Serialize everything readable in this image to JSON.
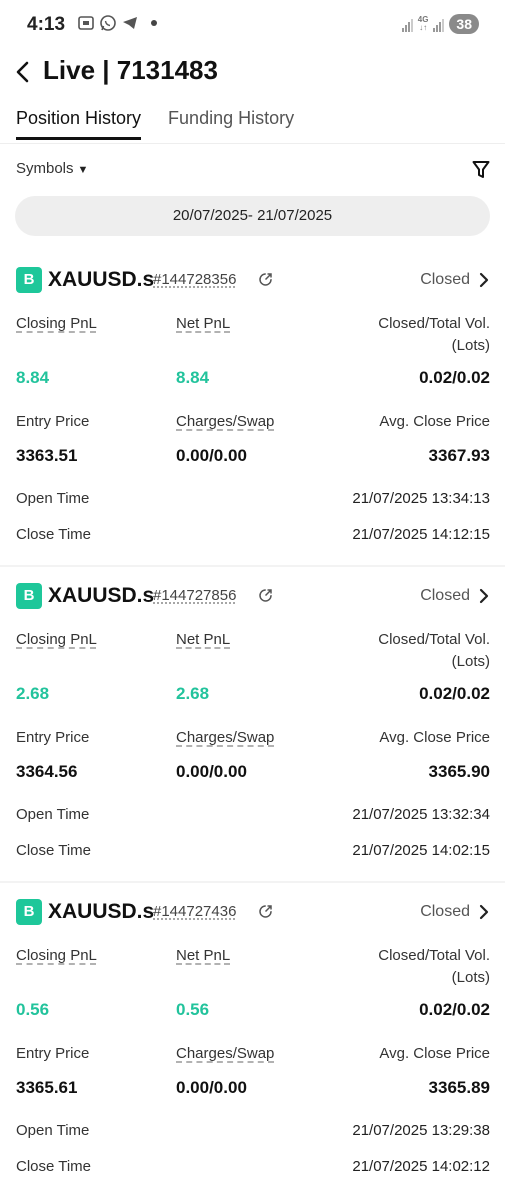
{
  "status_bar": {
    "time": "4:13",
    "network": "4G",
    "battery": "38"
  },
  "header": {
    "title": "Live | 7131483"
  },
  "tabs": [
    {
      "label": "Position History",
      "active": true
    },
    {
      "label": "Funding History",
      "active": false
    }
  ],
  "filter": {
    "symbols_label": "Symbols",
    "date_range": "20/07/2025- 21/07/2025"
  },
  "labels": {
    "closing_pnl": "Closing PnL",
    "net_pnl": "Net PnL",
    "closed_total_vol": "Closed/Total Vol.",
    "lots": "(Lots)",
    "entry_price": "Entry Price",
    "charges_swap": "Charges/Swap",
    "avg_close_price": "Avg. Close Price",
    "open_time": "Open Time",
    "close_time": "Close Time"
  },
  "positions": [
    {
      "badge": "B",
      "symbol": "XAUUSD.s",
      "order_id": "#144728356",
      "status": "Closed",
      "closing_pnl": "8.84",
      "net_pnl": "8.84",
      "volume": "0.02/0.02",
      "entry_price": "3363.51",
      "charges_swap": "0.00/0.00",
      "avg_close_price": "3367.93",
      "open_time": "21/07/2025 13:34:13",
      "close_time": "21/07/2025 14:12:15"
    },
    {
      "badge": "B",
      "symbol": "XAUUSD.s",
      "order_id": "#144727856",
      "status": "Closed",
      "closing_pnl": "2.68",
      "net_pnl": "2.68",
      "volume": "0.02/0.02",
      "entry_price": "3364.56",
      "charges_swap": "0.00/0.00",
      "avg_close_price": "3365.90",
      "open_time": "21/07/2025 13:32:34",
      "close_time": "21/07/2025 14:02:15"
    },
    {
      "badge": "B",
      "symbol": "XAUUSD.s",
      "order_id": "#144727436",
      "status": "Closed",
      "closing_pnl": "0.56",
      "net_pnl": "0.56",
      "volume": "0.02/0.02",
      "entry_price": "3365.61",
      "charges_swap": "0.00/0.00",
      "avg_close_price": "3365.89",
      "open_time": "21/07/2025 13:29:38",
      "close_time": "21/07/2025 14:02:12"
    }
  ],
  "colors": {
    "accent_green": "#22c39c",
    "badge_green": "#1ec79a"
  }
}
